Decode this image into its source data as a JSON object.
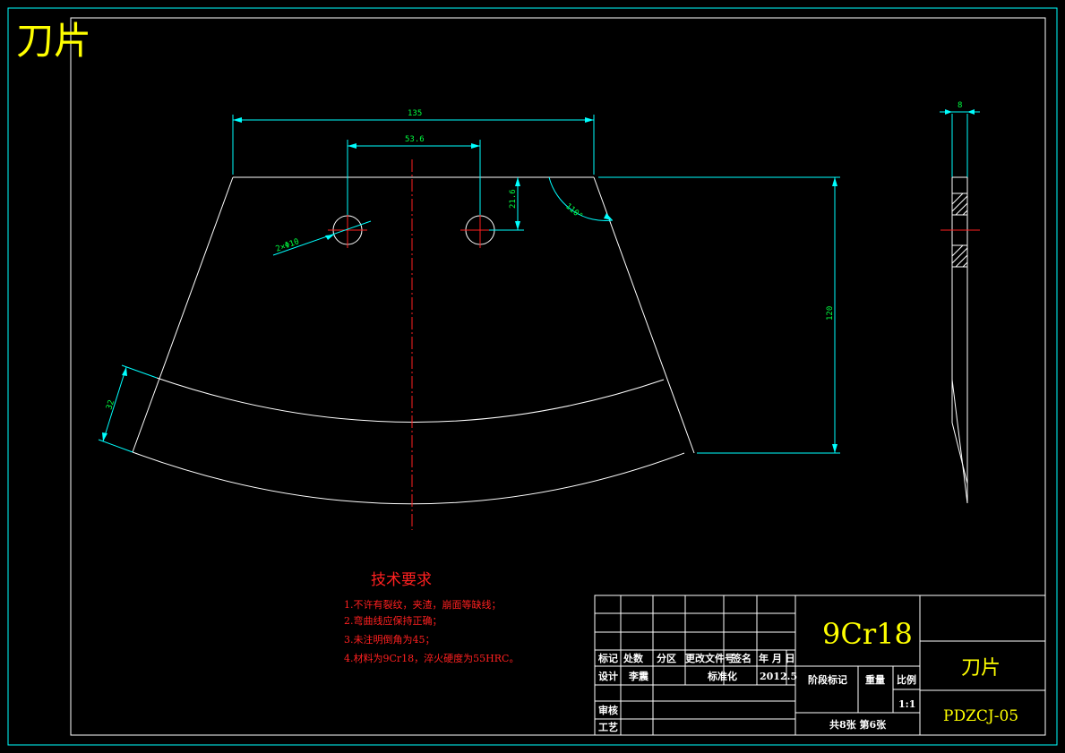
{
  "drawing_title": "刀片",
  "dimensions": {
    "top_width": "135",
    "hole_spacing": "53.6",
    "hole_offset": "21.6",
    "angle": "110°",
    "height": "120",
    "blade_width": "32",
    "holes": "2×Φ10",
    "thickness": "8"
  },
  "requirements": {
    "heading": "技术要求",
    "items": [
      "1.不许有裂纹，夹渣，崩面等缺线；",
      "2.弯曲线应保持正确；",
      "3.未注明倒角为45；",
      "4.材料为9Cr18，淬火硬度为55HRC。"
    ]
  },
  "title_block": {
    "material": "9Cr18",
    "part_name": "刀片",
    "drawing_no": "PDZCJ-05",
    "col_mark": "标记",
    "col_count": "处数",
    "col_zone": "分区",
    "col_change_doc": "更改文件号",
    "col_sign": "签名",
    "col_date": "年 月 日",
    "row_design": "设计",
    "designer": "李震",
    "standardize": "标准化",
    "date": "2012.5",
    "stage_mark": "阶段标记",
    "weight": "重量",
    "scale_label": "比例",
    "scale": "1:1",
    "row_review": "审核",
    "row_process": "工艺",
    "sheets": "共8张 第6张"
  },
  "colors": {
    "background": "#000000",
    "outline": "#ffffff",
    "dimension": "#00ffff",
    "dimension_text": "#00ff40",
    "centerline": "#ff2020",
    "title": "#ffff00"
  }
}
